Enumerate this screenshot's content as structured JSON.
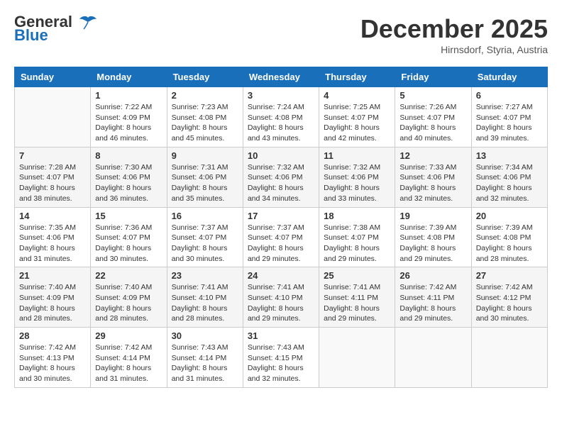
{
  "header": {
    "logo": {
      "line1": "General",
      "line2": "Blue"
    },
    "title": "December 2025",
    "location": "Hirnsdorf, Styria, Austria"
  },
  "weekdays": [
    "Sunday",
    "Monday",
    "Tuesday",
    "Wednesday",
    "Thursday",
    "Friday",
    "Saturday"
  ],
  "weeks": [
    [
      {
        "day": "",
        "info": ""
      },
      {
        "day": "1",
        "info": "Sunrise: 7:22 AM\nSunset: 4:09 PM\nDaylight: 8 hours\nand 46 minutes."
      },
      {
        "day": "2",
        "info": "Sunrise: 7:23 AM\nSunset: 4:08 PM\nDaylight: 8 hours\nand 45 minutes."
      },
      {
        "day": "3",
        "info": "Sunrise: 7:24 AM\nSunset: 4:08 PM\nDaylight: 8 hours\nand 43 minutes."
      },
      {
        "day": "4",
        "info": "Sunrise: 7:25 AM\nSunset: 4:07 PM\nDaylight: 8 hours\nand 42 minutes."
      },
      {
        "day": "5",
        "info": "Sunrise: 7:26 AM\nSunset: 4:07 PM\nDaylight: 8 hours\nand 40 minutes."
      },
      {
        "day": "6",
        "info": "Sunrise: 7:27 AM\nSunset: 4:07 PM\nDaylight: 8 hours\nand 39 minutes."
      }
    ],
    [
      {
        "day": "7",
        "info": "Sunrise: 7:28 AM\nSunset: 4:07 PM\nDaylight: 8 hours\nand 38 minutes."
      },
      {
        "day": "8",
        "info": "Sunrise: 7:30 AM\nSunset: 4:06 PM\nDaylight: 8 hours\nand 36 minutes."
      },
      {
        "day": "9",
        "info": "Sunrise: 7:31 AM\nSunset: 4:06 PM\nDaylight: 8 hours\nand 35 minutes."
      },
      {
        "day": "10",
        "info": "Sunrise: 7:32 AM\nSunset: 4:06 PM\nDaylight: 8 hours\nand 34 minutes."
      },
      {
        "day": "11",
        "info": "Sunrise: 7:32 AM\nSunset: 4:06 PM\nDaylight: 8 hours\nand 33 minutes."
      },
      {
        "day": "12",
        "info": "Sunrise: 7:33 AM\nSunset: 4:06 PM\nDaylight: 8 hours\nand 32 minutes."
      },
      {
        "day": "13",
        "info": "Sunrise: 7:34 AM\nSunset: 4:06 PM\nDaylight: 8 hours\nand 32 minutes."
      }
    ],
    [
      {
        "day": "14",
        "info": "Sunrise: 7:35 AM\nSunset: 4:06 PM\nDaylight: 8 hours\nand 31 minutes."
      },
      {
        "day": "15",
        "info": "Sunrise: 7:36 AM\nSunset: 4:07 PM\nDaylight: 8 hours\nand 30 minutes."
      },
      {
        "day": "16",
        "info": "Sunrise: 7:37 AM\nSunset: 4:07 PM\nDaylight: 8 hours\nand 30 minutes."
      },
      {
        "day": "17",
        "info": "Sunrise: 7:37 AM\nSunset: 4:07 PM\nDaylight: 8 hours\nand 29 minutes."
      },
      {
        "day": "18",
        "info": "Sunrise: 7:38 AM\nSunset: 4:07 PM\nDaylight: 8 hours\nand 29 minutes."
      },
      {
        "day": "19",
        "info": "Sunrise: 7:39 AM\nSunset: 4:08 PM\nDaylight: 8 hours\nand 29 minutes."
      },
      {
        "day": "20",
        "info": "Sunrise: 7:39 AM\nSunset: 4:08 PM\nDaylight: 8 hours\nand 28 minutes."
      }
    ],
    [
      {
        "day": "21",
        "info": "Sunrise: 7:40 AM\nSunset: 4:09 PM\nDaylight: 8 hours\nand 28 minutes."
      },
      {
        "day": "22",
        "info": "Sunrise: 7:40 AM\nSunset: 4:09 PM\nDaylight: 8 hours\nand 28 minutes."
      },
      {
        "day": "23",
        "info": "Sunrise: 7:41 AM\nSunset: 4:10 PM\nDaylight: 8 hours\nand 28 minutes."
      },
      {
        "day": "24",
        "info": "Sunrise: 7:41 AM\nSunset: 4:10 PM\nDaylight: 8 hours\nand 29 minutes."
      },
      {
        "day": "25",
        "info": "Sunrise: 7:41 AM\nSunset: 4:11 PM\nDaylight: 8 hours\nand 29 minutes."
      },
      {
        "day": "26",
        "info": "Sunrise: 7:42 AM\nSunset: 4:11 PM\nDaylight: 8 hours\nand 29 minutes."
      },
      {
        "day": "27",
        "info": "Sunrise: 7:42 AM\nSunset: 4:12 PM\nDaylight: 8 hours\nand 30 minutes."
      }
    ],
    [
      {
        "day": "28",
        "info": "Sunrise: 7:42 AM\nSunset: 4:13 PM\nDaylight: 8 hours\nand 30 minutes."
      },
      {
        "day": "29",
        "info": "Sunrise: 7:42 AM\nSunset: 4:14 PM\nDaylight: 8 hours\nand 31 minutes."
      },
      {
        "day": "30",
        "info": "Sunrise: 7:43 AM\nSunset: 4:14 PM\nDaylight: 8 hours\nand 31 minutes."
      },
      {
        "day": "31",
        "info": "Sunrise: 7:43 AM\nSunset: 4:15 PM\nDaylight: 8 hours\nand 32 minutes."
      },
      {
        "day": "",
        "info": ""
      },
      {
        "day": "",
        "info": ""
      },
      {
        "day": "",
        "info": ""
      }
    ]
  ]
}
